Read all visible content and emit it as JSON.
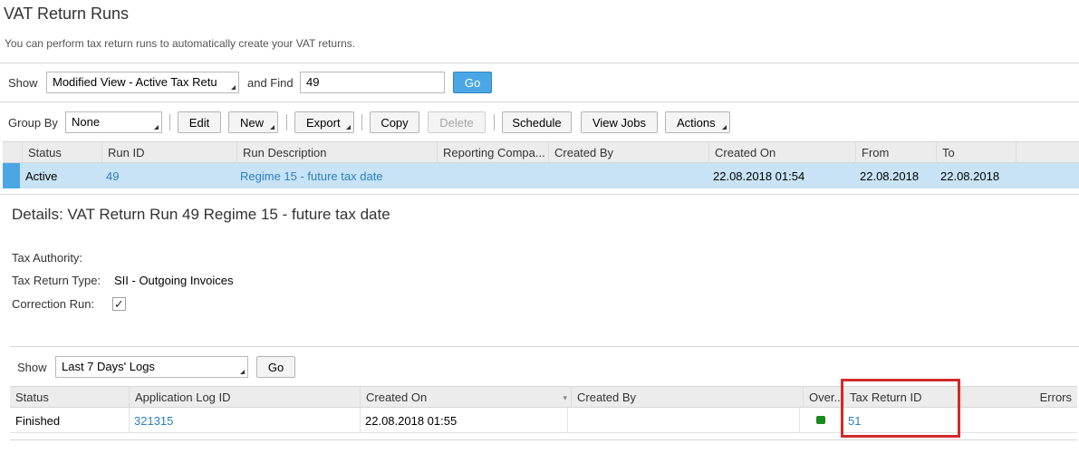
{
  "page": {
    "title": "VAT Return Runs",
    "subtitle": "You can perform tax return runs to automatically create your VAT returns."
  },
  "filter": {
    "show_label": "Show",
    "view_value": "Modified View - Active Tax Retu",
    "find_label": "and Find",
    "find_value": "49",
    "go_label": "Go"
  },
  "toolbar": {
    "group_by_label": "Group By",
    "group_by_value": "None",
    "edit": "Edit",
    "new": "New",
    "export": "Export",
    "copy": "Copy",
    "delete": "Delete",
    "schedule": "Schedule",
    "view_jobs": "View Jobs",
    "actions": "Actions"
  },
  "runs_table": {
    "columns": [
      "Status",
      "Run ID",
      "Run Description",
      "Reporting Compa...",
      "Created By",
      "Created On",
      "From",
      "To"
    ],
    "rows": [
      {
        "status": "Active",
        "run_id": "49",
        "description": "Regime 15 - future tax date",
        "reporting_company": "",
        "created_by": "",
        "created_on": "22.08.2018 01:54",
        "from": "22.08.2018",
        "to": "22.08.2018"
      }
    ]
  },
  "details": {
    "title": "Details: VAT Return Run 49 Regime 15 - future tax date",
    "tax_authority_label": "Tax Authority:",
    "tax_authority_value": "",
    "tax_return_type_label": "Tax Return Type:",
    "tax_return_type_value": "SII - Outgoing Invoices",
    "correction_run_label": "Correction Run:",
    "correction_run_checked": "✓"
  },
  "logs": {
    "show_label": "Show",
    "view_value": "Last 7 Days' Logs",
    "go_label": "Go",
    "columns": [
      "Status",
      "Application Log ID",
      "Created On",
      "Created By",
      "Over...",
      "Tax Return ID",
      "Errors"
    ],
    "rows": [
      {
        "status": "Finished",
        "app_log_id": "321315",
        "created_on": "22.08.2018 01:55",
        "created_by": "",
        "overall_status": "green",
        "tax_return_id": "51",
        "errors": ""
      }
    ]
  },
  "colors": {
    "accent": "#4aa7e3",
    "link": "#2d7fc1",
    "selected_row": "#c8e3f5",
    "highlight": "#d22b2b",
    "status_ok": "#1a8a1a"
  }
}
